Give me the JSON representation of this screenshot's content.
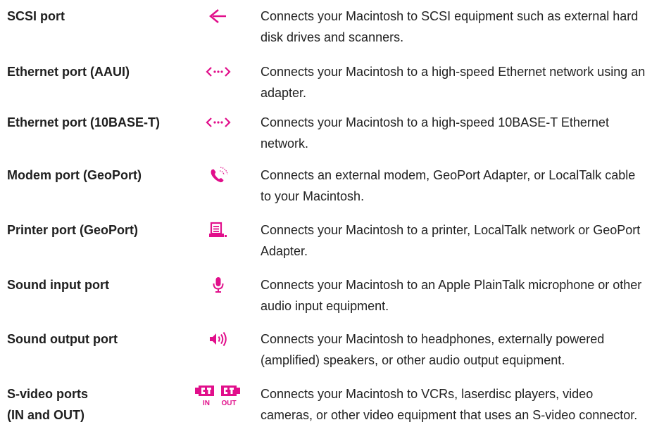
{
  "accent_color": "#E10F8B",
  "ports": [
    {
      "name": "SCSI port",
      "icon": "scsi-icon",
      "description": "Connects your Macintosh to SCSI equipment such as external hard disk drives and scanners."
    },
    {
      "name": "Ethernet port (AAUI)",
      "icon": "ethernet-icon",
      "description": "Connects your Macintosh to a high-speed Ethernet network using an adapter."
    },
    {
      "name": "Ethernet port (10BASE-T)",
      "icon": "ethernet-icon",
      "description": "Connects your Macintosh to a high-speed 10BASE-T Ethernet network."
    },
    {
      "name": "Modem port (GeoPort)",
      "icon": "modem-phone-icon",
      "description": "Connects an external modem, GeoPort Adapter, or LocalTalk cable to your Macintosh."
    },
    {
      "name": "Printer port (GeoPort)",
      "icon": "printer-icon",
      "description": "Connects your Macintosh to a printer, LocalTalk network or GeoPort Adapter."
    },
    {
      "name": "Sound input port",
      "icon": "microphone-icon",
      "description": "Connects your Macintosh to an Apple PlainTalk microphone or other audio input equipment."
    },
    {
      "name": "Sound output port",
      "icon": "speaker-icon",
      "description": "Connects your Macintosh to headphones, externally powered (amplified) speakers, or other audio output equipment."
    },
    {
      "name": "S-video ports\n(IN and OUT)",
      "icon": "s-video-icon",
      "icon_labels": [
        "IN",
        "OUT"
      ],
      "description": "Connects your Macintosh to VCRs, laserdisc players, video cameras, or other video equipment that uses an S-video connector."
    }
  ]
}
